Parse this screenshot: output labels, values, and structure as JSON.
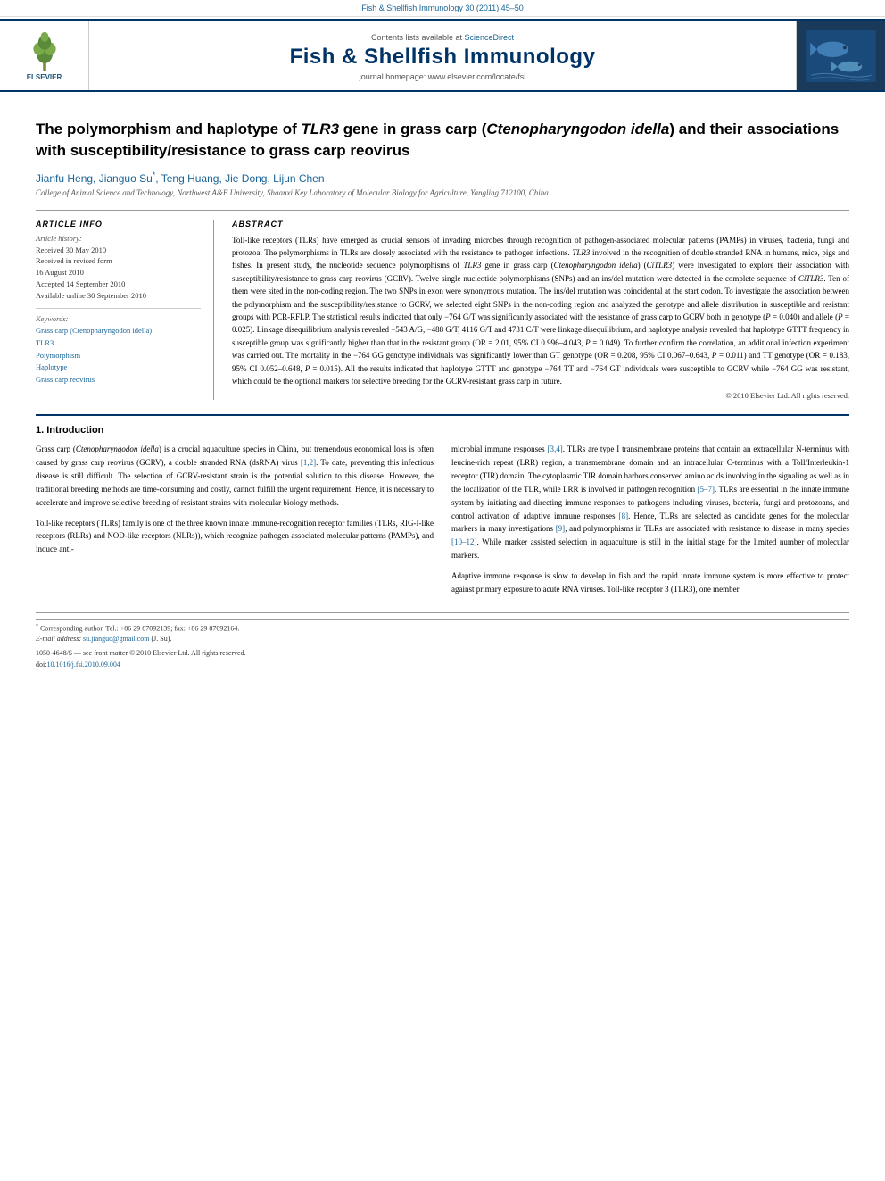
{
  "citation_line": "Fish & Shellfish Immunology 30 (2011) 45–50",
  "contents_line": "Contents lists available at ScienceDirect",
  "journal_name": "Fish & Shellfish Immunology",
  "journal_homepage": "journal homepage: www.elsevier.com/locate/fsi",
  "title": "The polymorphism and haplotype of TLR3 gene in grass carp (Ctenopharyngodon idella) and their associations with susceptibility/resistance to grass carp reovirus",
  "authors": "Jianfu Heng, Jianguo Su*, Teng Huang, Jie Dong, Lijun Chen",
  "affiliation": "College of Animal Science and Technology, Northwest A&F University, Shaanxi Key Laboratory of Molecular Biology for Agriculture, Yangling 712100, China",
  "article_info": {
    "label": "ARTICLE INFO",
    "history_label": "Article history:",
    "received": "Received 30 May 2010",
    "received_revised": "Received in revised form 16 August 2010",
    "accepted": "Accepted 14 September 2010",
    "available": "Available online 30 September 2010",
    "keywords_label": "Keywords:",
    "keywords": [
      "Grass carp (Ctenopharyngodon idella)",
      "TLR3",
      "Polymorphism",
      "Haplotype",
      "Grass carp reovirus"
    ]
  },
  "abstract": {
    "label": "ABSTRACT",
    "text": "Toll-like receptors (TLRs) have emerged as crucial sensors of invading microbes through recognition of pathogen-associated molecular patterns (PAMPs) in viruses, bacteria, fungi and protozoa. The polymorphisms in TLRs are closely associated with the resistance to pathogen infections. TLR3 involved in the recognition of double stranded RNA in humans, mice, pigs and fishes. In present study, the nucleotide sequence polymorphisms of TLR3 gene in grass carp (Ctenopharyngodon idella) (CiTLR3) were investigated to explore their association with susceptibility/resistance to grass carp reovirus (GCRV). Twelve single nucleotide polymorphisms (SNPs) and an ins/del mutation were detected in the complete sequence of CiTLR3. Ten of them were sited in the non-coding region. The two SNPs in exon were synonymous mutation. The ins/del mutation was coincidental at the start codon. To investigate the association between the polymorphism and the susceptibility/resistance to GCRV, we selected eight SNPs in the non-coding region and analyzed the genotype and allele distribution in susceptible and resistant groups with PCR-RFLP. The statistical results indicated that only −764 G/T was significantly associated with the resistance of grass carp to GCRV both in genotype (P = 0.040) and allele (P = 0.025). Linkage disequilibrium analysis revealed −543 A/G, −488 G/T, 4116 G/T and 4731 C/T were linkage disequilibrium, and haplotype analysis revealed that haplotype GTTT frequency in susceptible group was significantly higher than that in the resistant group (OR = 2.01, 95% CI 0.996–4.043, P = 0.049). To further confirm the correlation, an additional infection experiment was carried out. The mortality in the −764 GG genotype individuals was significantly lower than GT genotype (OR = 0.208, 95% CI 0.067–0.643, P = 0.011) and TT genotype (OR = 0.183, 95% CI 0.052–0.648, P = 0.015). All the results indicated that haplotype GTTT and genotype −764 TT and −764 GT individuals were susceptible to GCRV while −764 GG was resistant, which could be the optional markers for selective breeding for the GCRV-resistant grass carp in future.",
    "copyright": "© 2010 Elsevier Ltd. All rights reserved."
  },
  "section1": {
    "number": "1.",
    "title": "Introduction",
    "col1_paragraphs": [
      "Grass carp (Ctenopharyngodon idella) is a crucial aquaculture species in China, but tremendous economical loss is often caused by grass carp reovirus (GCRV), a double stranded RNA (dsRNA) virus [1,2]. To date, preventing this infectious disease is still difficult. The selection of GCRV-resistant strain is the potential solution to this disease. However, the traditional breeding methods are time-consuming and costly, cannot fulfill the urgent requirement. Hence, it is necessary to accelerate and improve selective breeding of resistant strains with molecular biology methods.",
      "Toll-like receptors (TLRs) family is one of the three known innate immune-recognition receptor families (TLRs, RIG-I-like receptors (RLRs) and NOD-like receptors (NLRs)), which recognize pathogen associated molecular patterns (PAMPs), and induce anti-"
    ],
    "col2_paragraphs": [
      "microbial immune responses [3,4]. TLRs are type I transmembrane proteins that contain an extracellular N-terminus with leucine-rich repeat (LRR) region, a transmembrane domain and an intracellular C-terminus with a Toll/Interleukin-1 receptor (TIR) domain. The cytoplasmic TIR domain harbors conserved amino acids involving in the signaling as well as in the localization of the TLR, while LRR is involved in pathogen recognition [5–7]. TLRs are essential in the innate immune system by initiating and directing immune responses to pathogens including viruses, bacteria, fungi and protozoans, and control activation of adaptive immune responses [8]. Hence, TLRs are selected as candidate genes for the molecular markers in many investigations [9], and polymorphisms in TLRs are associated with resistance to disease in many species [10–12]. While marker assisted selection in aquaculture is still in the initial stage for the limited number of molecular markers.",
      "Adaptive immune response is slow to develop in fish and the rapid innate immune system is more effective to protect against primary exposure to acute RNA viruses. Toll-like receptor 3 (TLR3), one member"
    ]
  },
  "footer": {
    "corresponding": "* Corresponding author. Tel.: +86 29 87092139; fax: +86 29 87092164.",
    "email": "E-mail address: su.jianguo@gmail.com (J. Su).",
    "issn_line": "1050-4648/$ — see front matter © 2010 Elsevier Ltd. All rights reserved.",
    "doi": "doi:10.1016/j.fsi.2010.09.004",
    "doi_link": "doi:10.1016/j.fsi.2010.09.004"
  }
}
